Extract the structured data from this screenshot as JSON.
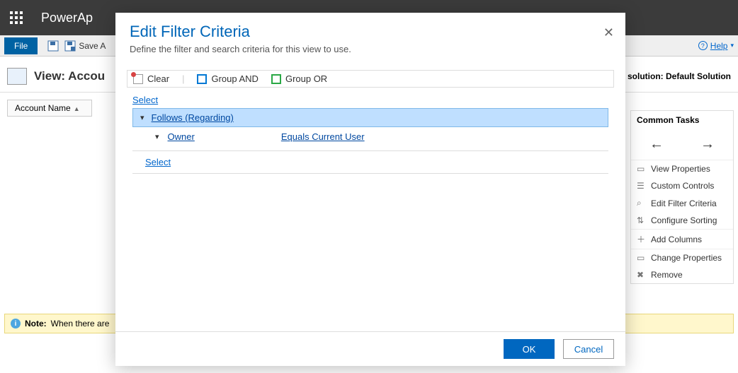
{
  "header": {
    "app_title": "PowerAp"
  },
  "subbar": {
    "file_label": "File",
    "save_label": "Save A",
    "help_label": "Help"
  },
  "view": {
    "title": "View: Accou",
    "solution_text": "n solution: Default Solution"
  },
  "columns": {
    "account_name": "Account Name"
  },
  "right_panel": {
    "header": "Common Tasks",
    "items": [
      "View Properties",
      "Custom Controls",
      "Edit Filter Criteria",
      "Configure Sorting",
      "Add Columns",
      "Change Properties",
      "Remove"
    ]
  },
  "info_bar": {
    "label": "Note:",
    "text": "When there are"
  },
  "modal": {
    "title": "Edit Filter Criteria",
    "subtitle": "Define the filter and search criteria for this view to use.",
    "toolbar": {
      "clear": "Clear",
      "group_and": "Group AND",
      "group_or": "Group OR"
    },
    "filter": {
      "select_top": "Select",
      "group_label": "Follows (Regarding)",
      "condition": {
        "field": "Owner",
        "operator": "Equals Current User"
      },
      "select_bottom": "Select"
    },
    "buttons": {
      "ok": "OK",
      "cancel": "Cancel"
    }
  }
}
